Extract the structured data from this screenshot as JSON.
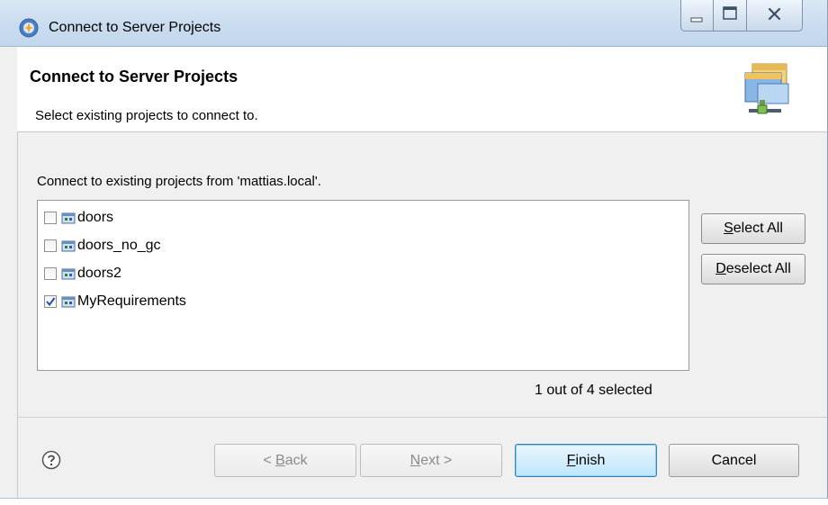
{
  "window": {
    "title": "Connect to Server Projects",
    "icon": "eclipse-wizard-icon"
  },
  "banner": {
    "title": "Connect to Server Projects",
    "description": "Select existing projects to connect to.",
    "icon": "server-projects-icon"
  },
  "content": {
    "label": "Connect to existing projects from 'mattias.local'.",
    "projects": [
      {
        "name": "doors",
        "checked": false
      },
      {
        "name": "doors_no_gc",
        "checked": false
      },
      {
        "name": "doors2",
        "checked": false
      },
      {
        "name": "MyRequirements",
        "checked": true
      }
    ],
    "select_all": {
      "mnemonic": "S",
      "rest": "elect All"
    },
    "deselect_all": {
      "mnemonic": "D",
      "rest": "eselect All"
    },
    "selection_status": "1 out of 4 selected"
  },
  "footer": {
    "back": {
      "pre": "< ",
      "mnemonic": "B",
      "rest": "ack"
    },
    "next": {
      "mnemonic": "N",
      "rest": "ext >"
    },
    "finish": {
      "mnemonic": "F",
      "rest": "inish"
    },
    "cancel": "Cancel"
  }
}
